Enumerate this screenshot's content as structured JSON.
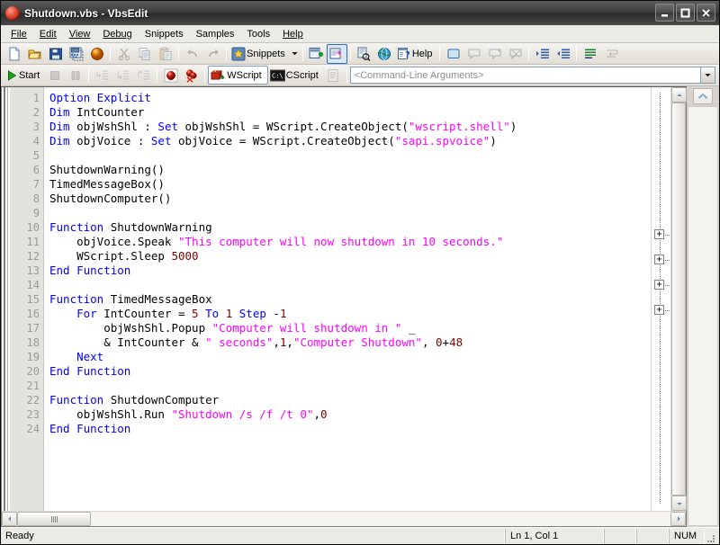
{
  "window": {
    "title": "Shutdown.vbs - VbsEdit",
    "icon": "red-sphere-icon",
    "buttons": {
      "minimize": "minimize-button",
      "maximize": "maximize-button",
      "close": "close-button"
    }
  },
  "menubar": {
    "items": [
      {
        "label": "File",
        "mnemonic": "F"
      },
      {
        "label": "Edit",
        "mnemonic": "E"
      },
      {
        "label": "View",
        "mnemonic": "V"
      },
      {
        "label": "Debug",
        "mnemonic": "D"
      },
      {
        "label": "Snippets",
        "mnemonic": "S"
      },
      {
        "label": "Samples",
        "mnemonic": "a"
      },
      {
        "label": "Tools",
        "mnemonic": "T"
      },
      {
        "label": "Help",
        "mnemonic": "H"
      }
    ]
  },
  "toolbar_main": {
    "items": [
      {
        "name": "new-file-button",
        "icon": "new-document-icon",
        "label": ""
      },
      {
        "name": "open-file-button",
        "icon": "open-folder-icon",
        "label": ""
      },
      {
        "name": "save-file-button",
        "icon": "floppy-disk-icon",
        "label": ""
      },
      {
        "name": "save-all-button",
        "icon": "save-all-icon",
        "label": ""
      },
      {
        "name": "encrypt-button",
        "icon": "orange-sphere-icon",
        "label": ""
      },
      {
        "name": "cut-button",
        "icon": "scissors-icon",
        "label": ""
      },
      {
        "name": "copy-button",
        "icon": "copy-pages-icon",
        "label": ""
      },
      {
        "name": "paste-button",
        "icon": "clipboard-paste-icon",
        "label": ""
      },
      {
        "name": "undo-button",
        "icon": "undo-arrow-icon",
        "label": ""
      },
      {
        "name": "redo-button",
        "icon": "redo-arrow-icon",
        "label": ""
      },
      {
        "name": "snippets-button",
        "icon": "yellow-star-icon",
        "label": "Snippets"
      },
      {
        "name": "snippets-dropdown",
        "icon": "chevron-down-icon",
        "label": ""
      },
      {
        "name": "add-snippet-button",
        "icon": "add-snippet-icon",
        "label": ""
      },
      {
        "name": "wizard-button",
        "icon": "script-wizard-icon",
        "label": ""
      },
      {
        "name": "print-preview-button",
        "icon": "print-preview-icon",
        "label": ""
      },
      {
        "name": "web-search-button",
        "icon": "globe-icon",
        "label": ""
      },
      {
        "name": "help-button",
        "icon": "help-question-icon",
        "label": "Help"
      },
      {
        "name": "watch-window-button",
        "icon": "blue-window-icon",
        "label": ""
      },
      {
        "name": "comment-add-button",
        "icon": "comment-icon",
        "label": ""
      },
      {
        "name": "comment-out-button",
        "icon": "comment-out-icon",
        "label": ""
      },
      {
        "name": "comment-remove-button",
        "icon": "comment-delete-icon",
        "label": ""
      },
      {
        "name": "indent-button",
        "icon": "indent-increase-icon",
        "label": ""
      },
      {
        "name": "outdent-button",
        "icon": "indent-decrease-icon",
        "label": ""
      },
      {
        "name": "format-code-button",
        "icon": "format-lines-icon",
        "label": ""
      },
      {
        "name": "wrap-lines-button",
        "icon": "wrap-lines-icon",
        "label": ""
      }
    ],
    "snippets_label": "Snippets",
    "help_label": "Help"
  },
  "toolbar_debug": {
    "start_label": "Start",
    "wscript_label": "WScript",
    "cscript_label": "CScript",
    "items": [
      {
        "name": "start-button",
        "icon": "green-play-icon"
      },
      {
        "name": "stop-button",
        "icon": "stop-square-icon"
      },
      {
        "name": "pause-button",
        "icon": "pause-bars-icon"
      },
      {
        "name": "step-into-button",
        "icon": "step-into-icon"
      },
      {
        "name": "step-over-button",
        "icon": "step-over-icon"
      },
      {
        "name": "step-out-button",
        "icon": "step-out-icon"
      },
      {
        "name": "toggle-breakpoint-button",
        "icon": "red-breakpoint-icon"
      },
      {
        "name": "clear-breakpoints-button",
        "icon": "clear-breakpoints-icon"
      },
      {
        "name": "wscript-host-button",
        "icon": "wscript-icon"
      },
      {
        "name": "cscript-host-button",
        "icon": "cscript-console-icon"
      },
      {
        "name": "output-window-button",
        "icon": "output-lines-icon"
      }
    ]
  },
  "command_line": {
    "placeholder": "<Command-Line Arguments>",
    "value": "",
    "dropdown_icon": "chevron-down-icon"
  },
  "editor": {
    "first_line": 1,
    "lines": [
      {
        "n": 1,
        "tokens": [
          {
            "t": "kw",
            "v": "Option Explicit"
          }
        ]
      },
      {
        "n": 2,
        "tokens": [
          {
            "t": "kw",
            "v": "Dim"
          },
          {
            "t": "p",
            "v": " IntCounter"
          }
        ]
      },
      {
        "n": 3,
        "tokens": [
          {
            "t": "kw",
            "v": "Dim"
          },
          {
            "t": "p",
            "v": " objWshShl : "
          },
          {
            "t": "kw",
            "v": "Set"
          },
          {
            "t": "p",
            "v": " objWshShl = WScript.CreateObject("
          },
          {
            "t": "str",
            "v": "\"wscript.shell\""
          },
          {
            "t": "p",
            "v": ")"
          }
        ]
      },
      {
        "n": 4,
        "tokens": [
          {
            "t": "kw",
            "v": "Dim"
          },
          {
            "t": "p",
            "v": " objVoice : "
          },
          {
            "t": "kw",
            "v": "Set"
          },
          {
            "t": "p",
            "v": " objVoice = WScript.CreateObject("
          },
          {
            "t": "str",
            "v": "\"sapi.spvoice\""
          },
          {
            "t": "p",
            "v": ")"
          }
        ]
      },
      {
        "n": 5,
        "tokens": []
      },
      {
        "n": 6,
        "tokens": [
          {
            "t": "p",
            "v": "ShutdownWarning()"
          }
        ]
      },
      {
        "n": 7,
        "tokens": [
          {
            "t": "p",
            "v": "TimedMessageBox()"
          }
        ]
      },
      {
        "n": 8,
        "tokens": [
          {
            "t": "p",
            "v": "ShutdownComputer()"
          }
        ]
      },
      {
        "n": 9,
        "tokens": []
      },
      {
        "n": 10,
        "tokens": [
          {
            "t": "kw",
            "v": "Function"
          },
          {
            "t": "p",
            "v": " ShutdownWarning"
          }
        ]
      },
      {
        "n": 11,
        "tokens": [
          {
            "t": "p",
            "v": "    objVoice.Speak "
          },
          {
            "t": "str",
            "v": "\"This computer will now shutdown in 10 seconds.\""
          }
        ]
      },
      {
        "n": 12,
        "tokens": [
          {
            "t": "p",
            "v": "    WScript.Sleep "
          },
          {
            "t": "num",
            "v": "5000"
          }
        ]
      },
      {
        "n": 13,
        "tokens": [
          {
            "t": "kw",
            "v": "End Function"
          }
        ]
      },
      {
        "n": 14,
        "tokens": []
      },
      {
        "n": 15,
        "tokens": [
          {
            "t": "kw",
            "v": "Function"
          },
          {
            "t": "p",
            "v": " TimedMessageBox"
          }
        ]
      },
      {
        "n": 16,
        "tokens": [
          {
            "t": "p",
            "v": "    "
          },
          {
            "t": "kw",
            "v": "For"
          },
          {
            "t": "p",
            "v": " IntCounter = "
          },
          {
            "t": "num",
            "v": "5"
          },
          {
            "t": "p",
            "v": " "
          },
          {
            "t": "kw",
            "v": "To"
          },
          {
            "t": "p",
            "v": " "
          },
          {
            "t": "num",
            "v": "1"
          },
          {
            "t": "p",
            "v": " "
          },
          {
            "t": "kw",
            "v": "Step"
          },
          {
            "t": "p",
            "v": " -"
          },
          {
            "t": "num",
            "v": "1"
          }
        ]
      },
      {
        "n": 17,
        "tokens": [
          {
            "t": "p",
            "v": "        objWshShl.Popup "
          },
          {
            "t": "str",
            "v": "\"Computer will shutdown in \""
          },
          {
            "t": "p",
            "v": " _"
          }
        ]
      },
      {
        "n": 18,
        "tokens": [
          {
            "t": "p",
            "v": "        & IntCounter & "
          },
          {
            "t": "str",
            "v": "\" seconds\""
          },
          {
            "t": "p",
            "v": ","
          },
          {
            "t": "num",
            "v": "1"
          },
          {
            "t": "p",
            "v": ","
          },
          {
            "t": "str",
            "v": "\"Computer Shutdown\""
          },
          {
            "t": "p",
            "v": ", "
          },
          {
            "t": "num",
            "v": "0"
          },
          {
            "t": "p",
            "v": "+"
          },
          {
            "t": "num",
            "v": "48"
          }
        ]
      },
      {
        "n": 19,
        "tokens": [
          {
            "t": "p",
            "v": "    "
          },
          {
            "t": "kw",
            "v": "Next"
          }
        ]
      },
      {
        "n": 20,
        "tokens": [
          {
            "t": "kw",
            "v": "End Function"
          }
        ]
      },
      {
        "n": 21,
        "tokens": []
      },
      {
        "n": 22,
        "tokens": [
          {
            "t": "kw",
            "v": "Function"
          },
          {
            "t": "p",
            "v": " ShutdownComputer"
          }
        ]
      },
      {
        "n": 23,
        "tokens": [
          {
            "t": "p",
            "v": "    objWshShl.Run "
          },
          {
            "t": "str",
            "v": "\"Shutdown /s /f /t 0\""
          },
          {
            "t": "p",
            "v": ","
          },
          {
            "t": "num",
            "v": "0"
          }
        ]
      },
      {
        "n": 24,
        "tokens": [
          {
            "t": "kw",
            "v": "End Function"
          }
        ]
      }
    ],
    "fold_markers": [
      "+",
      "+",
      "+",
      "+"
    ],
    "colors": {
      "keyword": "#0000ff",
      "string": "#ff00ff",
      "number": "#800000",
      "plain": "#000000",
      "background": "#ffffff",
      "gutter": "#e4e2dd",
      "line_number": "#9a9a9a"
    }
  },
  "statusbar": {
    "message": "Ready",
    "position": "Ln 1, Col 1",
    "cell_a": "",
    "cell_b": "",
    "num_lock": "NUM"
  }
}
